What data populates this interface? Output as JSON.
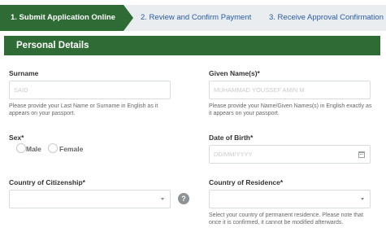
{
  "stepper": {
    "step1": "1. Submit Application Online",
    "step2": "2. Review and Confirm Payment",
    "step3": "3. Receive Approval Confirmation"
  },
  "section": {
    "title": "Personal Details"
  },
  "surname": {
    "label": "Surname",
    "value": "SAID",
    "help": "Please provide your Last Name or Surname in English as it appears on your passport."
  },
  "given_names": {
    "label": "Given Name(s)*",
    "value": "MUHAMMAD YOUSSEF AMIN M",
    "help": "Please provide your Name/Given Names(s) in English exactly as it appears on your passport."
  },
  "sex": {
    "label": "Sex*",
    "options": [
      "Male",
      "Female"
    ]
  },
  "dob": {
    "label": "Date of Birth*",
    "placeholder": "DD/MM/YYYY",
    "icon": "calendar-icon"
  },
  "citizenship": {
    "label": "Country of Citizenship*",
    "help_glyph": "?"
  },
  "residence": {
    "label": "Country of Residence*",
    "help": "Select your country of permanent residence. Please note that once it is confirmed, it cannot be modified afterwards."
  },
  "colors": {
    "brand_green": "#2f6b34",
    "step_link": "#2b5ba8",
    "stepper_bg": "#e9edef"
  }
}
